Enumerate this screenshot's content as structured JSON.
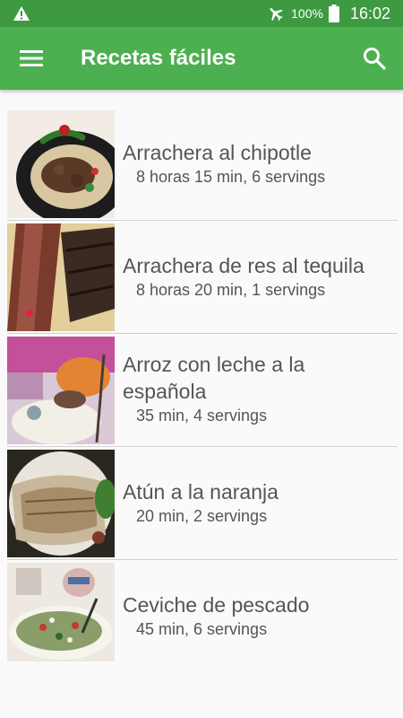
{
  "status_bar": {
    "battery": "100%",
    "time": "16:02"
  },
  "app_bar": {
    "title": "Recetas fáciles",
    "accent": "#4caf50"
  },
  "recipes": [
    {
      "name": "Arrachera al chipotle",
      "meta": "8 horas 15 min, 6 servings",
      "image": "arrachera-chipotle-photo"
    },
    {
      "name": "Arrachera de res al tequila",
      "meta": "8 horas 20 min, 1 servings",
      "image": "arrachera-tequila-photo"
    },
    {
      "name": "Arroz con leche a la española",
      "meta": "35 min, 4 servings",
      "image": "arroz-con-leche-photo"
    },
    {
      "name": "Atún a la naranja",
      "meta": "20 min, 2 servings",
      "image": "atun-naranja-photo"
    },
    {
      "name": "Ceviche de pescado",
      "meta": "45 min, 6 servings",
      "image": "ceviche-photo"
    }
  ]
}
